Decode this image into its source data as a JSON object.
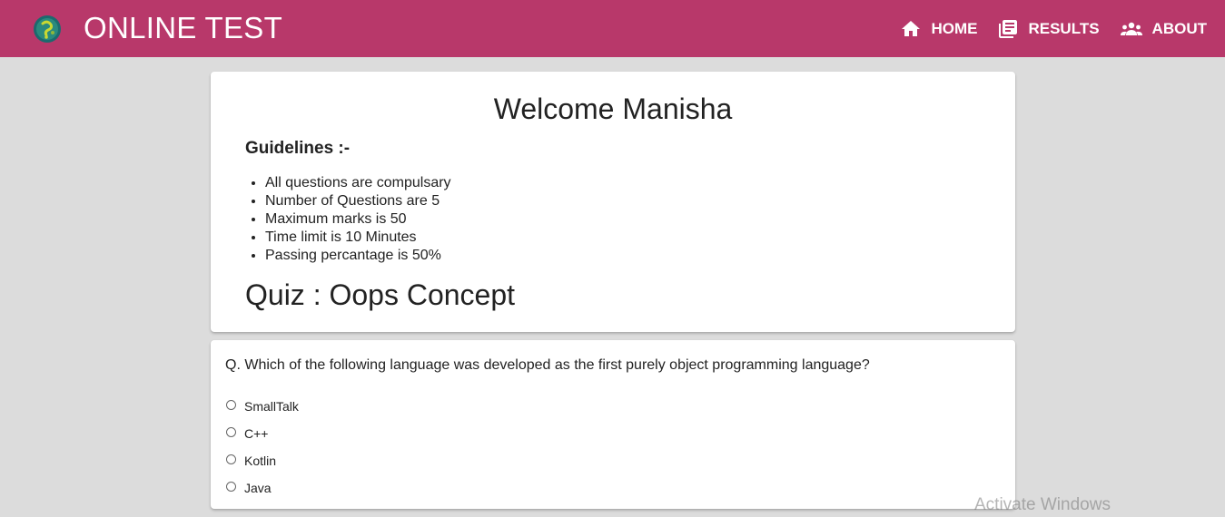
{
  "navbar": {
    "brand": "ONLINE TEST",
    "logo_icon": "quiz-logo-icon",
    "links": [
      {
        "label": "HOME",
        "icon": "home-icon"
      },
      {
        "label": "RESULTS",
        "icon": "library-books-icon"
      },
      {
        "label": "ABOUT",
        "icon": "people-icon"
      }
    ],
    "colors": {
      "background": "#b8386a",
      "text": "#ffffff"
    }
  },
  "welcome": {
    "title": "Welcome Manisha",
    "guidelines_title": "Guidelines :-",
    "guidelines": [
      "All questions are compulsary",
      "Number of Questions are 5",
      "Maximum marks is 50",
      "Time limit is 10 Minutes",
      "Passing percantage is 50%"
    ],
    "quiz_title": "Quiz : Oops Concept"
  },
  "question": {
    "text": "Q. Which of the following language was developed as the first purely object programming language?",
    "options": [
      "SmallTalk",
      "C++",
      "Kotlin",
      "Java"
    ],
    "selected": null
  },
  "watermark": "Activate Windows",
  "colors": {
    "page_background": "#dcdcdc",
    "card_background": "#ffffff"
  }
}
